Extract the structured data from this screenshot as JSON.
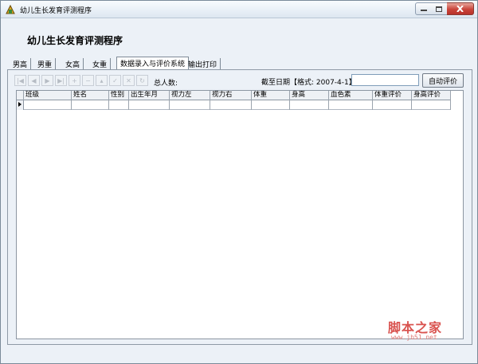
{
  "window": {
    "title": "幼儿生长发育评测程序"
  },
  "header": {
    "heading": "幼儿生长发育评测程序"
  },
  "tabs": [
    {
      "label": "男高"
    },
    {
      "label": "男重"
    },
    {
      "label": "女高"
    },
    {
      "label": "女重"
    },
    {
      "label": "数据录入与评价系统"
    },
    {
      "label": "输出打印"
    }
  ],
  "active_tab": "数据录入与评价系统",
  "toolbar": {
    "nav_icons": [
      "first-icon",
      "prior-icon",
      "next-icon",
      "last-icon",
      "insert-icon",
      "delete-icon",
      "edit-icon",
      "post-icon",
      "cancel-icon",
      "refresh-icon"
    ],
    "total_label": "总人数:",
    "date_label": "截至日期【格式: 2007-4-1】",
    "date_value": "",
    "auto_button": "自动评价"
  },
  "grid": {
    "columns": [
      "班级",
      "姓名",
      "性别",
      "出生年月",
      "视力左",
      "视力右",
      "体重",
      "身高",
      "血色素",
      "体重评价",
      "身高评价"
    ]
  },
  "watermark": {
    "text": "脚本之家",
    "url": "www.jb51.net"
  },
  "colors": {
    "background": "#ecf1f7",
    "close_button": "#c9443a",
    "watermark": "#d9534f"
  }
}
